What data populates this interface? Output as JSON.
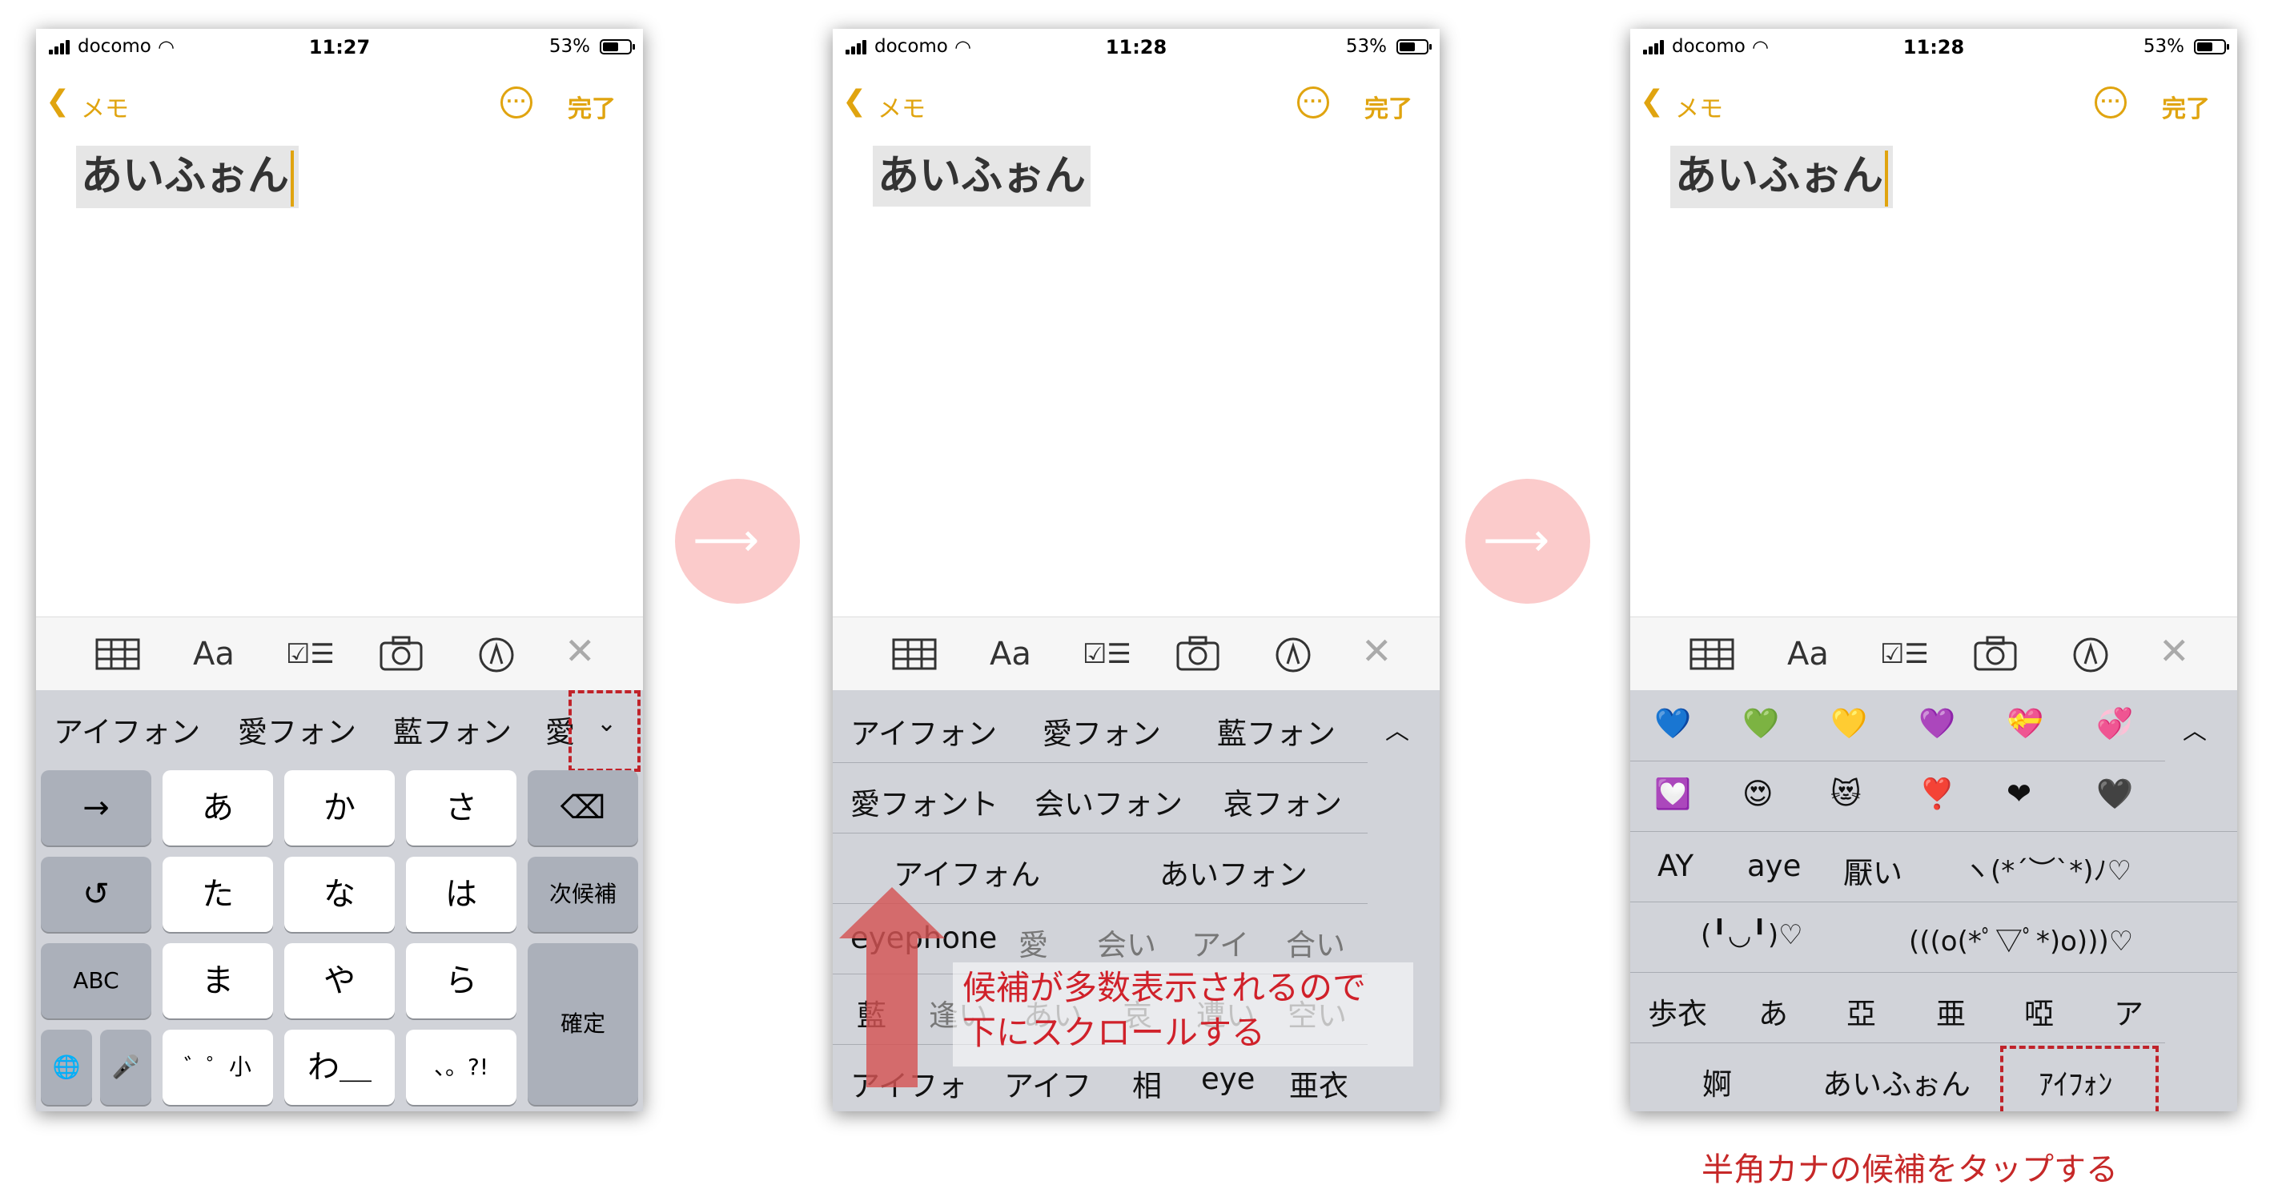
{
  "status": {
    "carrier": "docomo",
    "battery": "53%",
    "time1": "11:27",
    "time2": "11:28",
    "time3": "11:28"
  },
  "nav": {
    "back_label": "メモ",
    "more_glyph": "···",
    "done": "完了"
  },
  "note_text": "あいふぉん",
  "toolbar": {
    "format_label": "Aa",
    "close_glyph": "✕"
  },
  "colors": {
    "accent": "#e0a40f",
    "annotation": "#c0232a",
    "arrow_circle": "#fbcbcb"
  },
  "phone1": {
    "candidates": [
      "アイフォン",
      "愛フォン",
      "藍フォン",
      "愛"
    ],
    "keys": {
      "r1": [
        "→",
        "あ",
        "か",
        "さ",
        "⌫"
      ],
      "r2": [
        "↺",
        "た",
        "な",
        "は",
        "次候補"
      ],
      "r3": [
        "ABC",
        "ま",
        "や",
        "ら",
        "確定"
      ],
      "r4": [
        "🌐",
        "🎤",
        "゛゜小",
        "わ＿",
        "、。?!"
      ]
    }
  },
  "phone2": {
    "rows": [
      [
        "アイフォン",
        "愛フォン",
        "藍フォン"
      ],
      [
        "愛フォント",
        "会いフォン",
        "哀フォン"
      ],
      [
        "アイフォん",
        "あいフォン"
      ],
      [
        "eyephone",
        "愛",
        "会い",
        "アイ",
        "合い"
      ],
      [
        "藍",
        "逢い",
        "あい",
        "哀",
        "遭い",
        "空い"
      ],
      [
        "アイフォ",
        "アイフ",
        "相",
        "eye",
        "亜衣"
      ]
    ],
    "annotation": [
      "候補が多数表示されるので",
      "下にスクロールする"
    ]
  },
  "phone3": {
    "emoji_rows": [
      [
        "💙",
        "💚",
        "💛",
        "💜",
        "💝",
        "💞"
      ],
      [
        "💟",
        "😍",
        "😻",
        "❣️",
        "❤",
        "🖤"
      ]
    ],
    "rows": [
      [
        "AY",
        "aye",
        "厭い",
        "ヽ(*´︶`*)ﾉ♡"
      ],
      [
        "(╹◡╹)♡",
        "(((o(*ﾟ▽ﾟ*)o)))♡"
      ],
      [
        "歩衣",
        "あ",
        "亞",
        "亜",
        "啞",
        "ア"
      ],
      [
        "婀",
        "あいふぉん",
        "ｱｲﾌｫﾝ"
      ]
    ]
  },
  "caption": "半角カナの候補をタップする"
}
